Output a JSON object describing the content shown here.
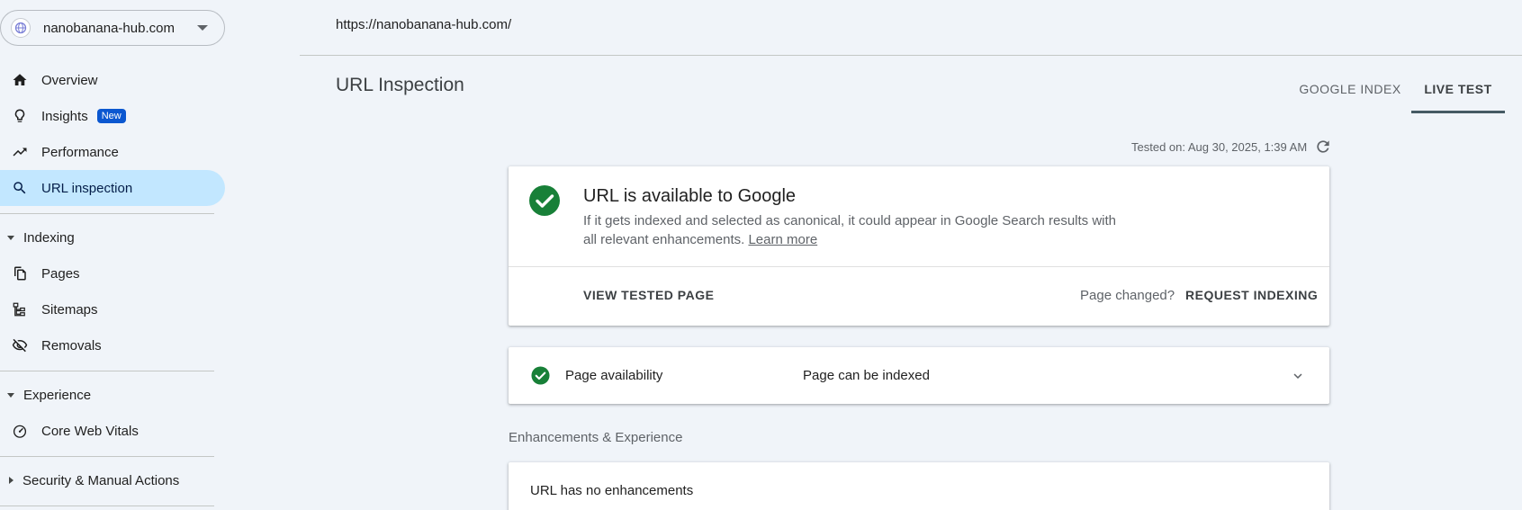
{
  "sidebar": {
    "property": "nanobanana-hub.com",
    "items": {
      "overview": "Overview",
      "insights": "Insights",
      "insights_badge": "New",
      "performance": "Performance",
      "url_inspection": "URL inspection",
      "pages": "Pages",
      "sitemaps": "Sitemaps",
      "removals": "Removals",
      "core_web_vitals": "Core Web Vitals"
    },
    "sections": {
      "indexing": "Indexing",
      "experience": "Experience",
      "security": "Security & Manual Actions"
    },
    "active_item": "url_inspection"
  },
  "main": {
    "url": "https://nanobanana-hub.com/",
    "title": "URL Inspection",
    "tabs": [
      {
        "label": "GOOGLE INDEX",
        "selected": false
      },
      {
        "label": "LIVE TEST",
        "selected": true
      }
    ],
    "tested_on": "Tested on: Aug 30, 2025, 1:39 AM",
    "status_card": {
      "title": "URL is available to Google",
      "description": "If it gets indexed and selected as canonical, it could appear in Google Search results with all relevant enhancements.",
      "learn_more": "Learn more",
      "view_tested_page": "VIEW TESTED PAGE",
      "page_changed": "Page changed?",
      "request_indexing": "REQUEST INDEXING"
    },
    "availability": {
      "label": "Page availability",
      "value": "Page can be indexed"
    },
    "enhancements_heading": "Enhancements & Experience",
    "enhancements_text": "URL has no enhancements"
  },
  "colors": {
    "background": "#f0f4f9",
    "active_nav": "#c2e7ff",
    "success_green": "#188038",
    "badge_blue": "#0b57d0",
    "tab_underline": "#455a64"
  },
  "icons": {
    "property": "globe-icon",
    "overview": "home-icon",
    "insights": "lightbulb-icon",
    "performance": "trending-up-icon",
    "url_inspection": "search-icon",
    "pages": "copy-pages-icon",
    "sitemaps": "sitemap-icon",
    "removals": "eye-off-icon",
    "core_web_vitals": "speedometer-icon",
    "refresh": "refresh-icon",
    "status": "check-circle-icon",
    "expand": "chevron-down-icon"
  }
}
